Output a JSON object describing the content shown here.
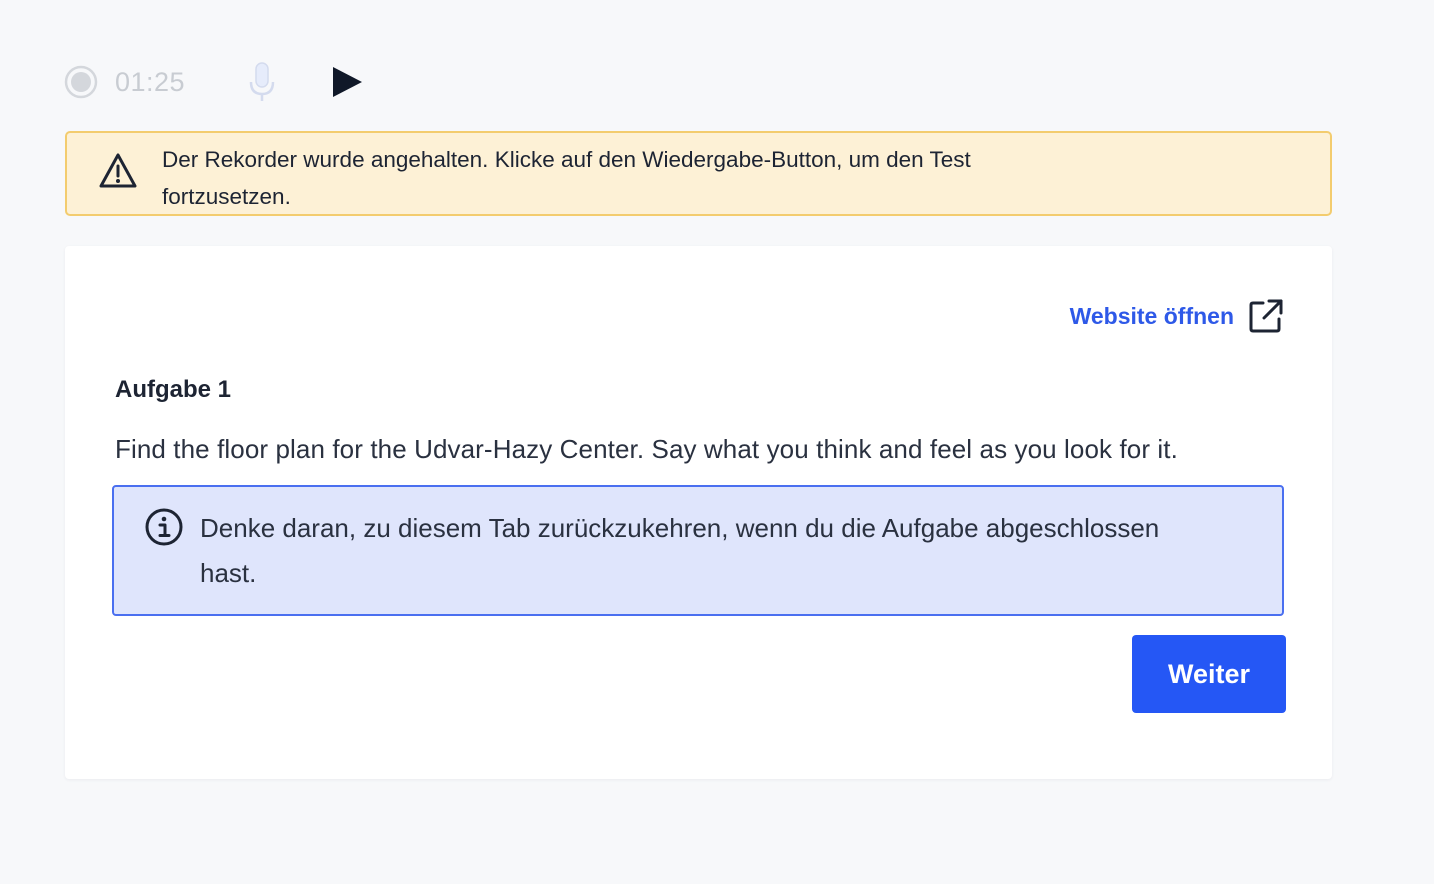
{
  "recorder": {
    "timer": "01:25",
    "icons": {
      "record": "record-icon",
      "mic": "microphone-icon",
      "play": "play-icon"
    }
  },
  "warning": {
    "icon": "warning-triangle-icon",
    "text": "Der Rekorder wurde angehalten. Klicke auf den Wiedergabe-Button, um den Test fortzusetzen."
  },
  "task": {
    "open_website_label": "Website öffnen",
    "open_website_icon": "external-link-icon",
    "title": "Aufgabe 1",
    "description": "Find the floor plan for the Udvar-Hazy Center. Say what you think and feel as you look for it.",
    "info": {
      "icon": "info-icon",
      "text": "Denke daran, zu diesem Tab zurückzukehren, wenn du die Aufgabe abgeschlossen hast."
    },
    "next_label": "Weiter"
  },
  "colors": {
    "accent": "#2557f5",
    "link": "#2e59e8",
    "warning_bg": "#fdf1d6",
    "warning_border": "#f3cc6e",
    "info_bg": "#dfe5fc",
    "info_border": "#4a6ff0"
  }
}
